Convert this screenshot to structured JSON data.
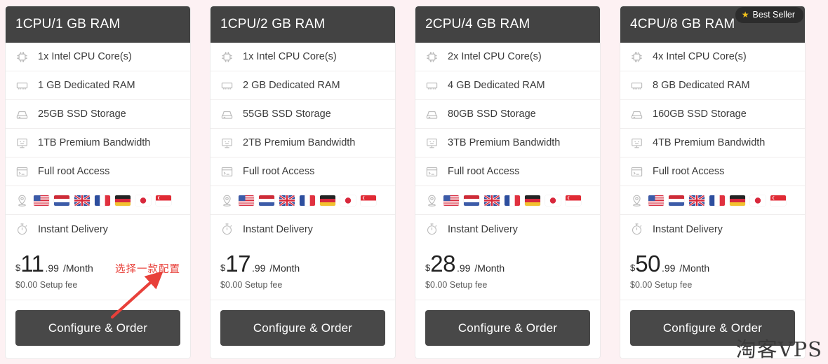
{
  "page": {
    "background_color": "#fdf1f3",
    "watermark": "淘客VPS"
  },
  "badge": {
    "label": "Best Seller",
    "icon": "star-icon",
    "background_color": "#2c2c2c",
    "star_color": "#f0c01c"
  },
  "annotation": {
    "text": "选择一款配置",
    "color": "#e8403a",
    "arrow": "red-arrow-pointing-up-right"
  },
  "common": {
    "button_label": "Configure & Order",
    "setup_fee": "$0.00 Setup fee",
    "currency": "$",
    "cents": ".99",
    "period": "/Month",
    "root_access": "Full root Access",
    "instant_delivery": "Instant Delivery",
    "header_color": "#434343",
    "button_color": "#484848"
  },
  "locations": [
    {
      "name": "united-states",
      "label": "US"
    },
    {
      "name": "netherlands",
      "label": "NL"
    },
    {
      "name": "united-kingdom",
      "label": "UK"
    },
    {
      "name": "france",
      "label": "FR"
    },
    {
      "name": "germany",
      "label": "DE"
    },
    {
      "name": "japan",
      "label": "JP"
    },
    {
      "name": "singapore",
      "label": "SG"
    }
  ],
  "plans": [
    {
      "title": "1CPU/1 GB RAM",
      "cpu": "1x Intel CPU Core(s)",
      "ram": "1 GB Dedicated RAM",
      "storage": "25GB SSD Storage",
      "bandwidth": "1TB Premium Bandwidth",
      "root": "Full root Access",
      "delivery": "Instant Delivery",
      "price_amount": "11",
      "price_cents": ".99",
      "price_period": "/Month",
      "setup_fee": "$0.00 Setup fee",
      "button": "Configure & Order",
      "best_seller": false
    },
    {
      "title": "1CPU/2 GB RAM",
      "cpu": "1x Intel CPU Core(s)",
      "ram": "2 GB Dedicated RAM",
      "storage": "55GB SSD Storage",
      "bandwidth": "2TB Premium Bandwidth",
      "root": "Full root Access",
      "delivery": "Instant Delivery",
      "price_amount": "17",
      "price_cents": ".99",
      "price_period": "/Month",
      "setup_fee": "$0.00 Setup fee",
      "button": "Configure & Order",
      "best_seller": false
    },
    {
      "title": "2CPU/4 GB RAM",
      "cpu": "2x Intel CPU Core(s)",
      "ram": "4 GB Dedicated RAM",
      "storage": "80GB SSD Storage",
      "bandwidth": "3TB Premium Bandwidth",
      "root": "Full root Access",
      "delivery": "Instant Delivery",
      "price_amount": "28",
      "price_cents": ".99",
      "price_period": "/Month",
      "setup_fee": "$0.00 Setup fee",
      "button": "Configure & Order",
      "best_seller": false
    },
    {
      "title": "4CPU/8 GB RAM",
      "cpu": "4x Intel CPU Core(s)",
      "ram": "8 GB Dedicated RAM",
      "storage": "160GB SSD Storage",
      "bandwidth": "4TB Premium Bandwidth",
      "root": "Full root Access",
      "delivery": "Instant Delivery",
      "price_amount": "50",
      "price_cents": ".99",
      "price_period": "/Month",
      "setup_fee": "$0.00 Setup fee",
      "button": "Configure & Order",
      "best_seller": true
    }
  ]
}
